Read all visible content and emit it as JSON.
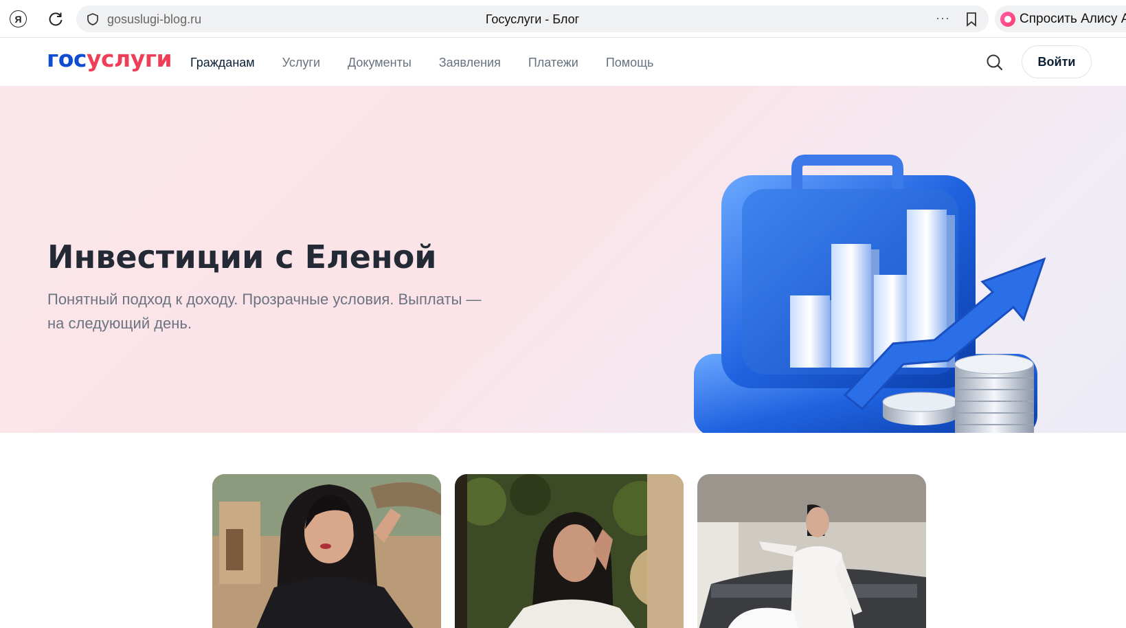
{
  "browser": {
    "yandex_button": "Я",
    "address_url": "gosuslugi-blog.ru",
    "tab_title": "Госуслуги - Блог",
    "more_dots": "···",
    "alice_label": "Спросить Алису А"
  },
  "header": {
    "logo_part1": "гос",
    "logo_part2": "услуги",
    "nav": [
      {
        "label": "Гражданам"
      },
      {
        "label": "Услуги"
      },
      {
        "label": "Документы"
      },
      {
        "label": "Заявления"
      },
      {
        "label": "Платежи"
      },
      {
        "label": "Помощь"
      }
    ],
    "login_label": "Войти"
  },
  "hero": {
    "title": "Инвестиции с Еленой",
    "subtitle": "Понятный подход к доходу. Прозрачные условия. Выплаты — на следующий день."
  },
  "colors": {
    "brand_blue": "#0d4cd3",
    "brand_red": "#ee3f58",
    "hero_bg": "#fbe7ea"
  },
  "icons": [
    "yandex-icon",
    "reload-icon",
    "shield-icon",
    "bookmark-icon",
    "alice-icon",
    "search-icon"
  ]
}
